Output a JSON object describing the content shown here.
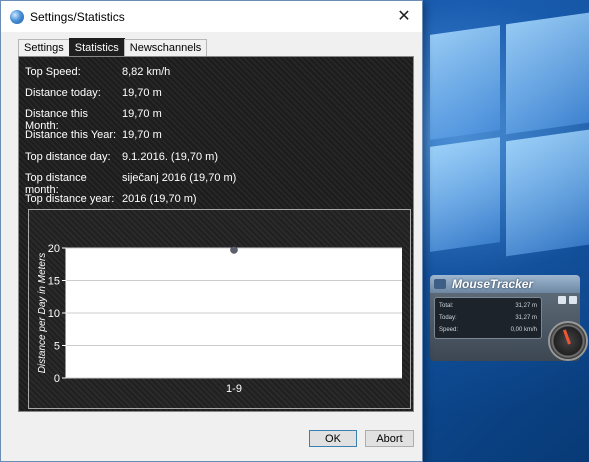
{
  "window": {
    "title": "Settings/Statistics",
    "close_glyph": "✕"
  },
  "tabs": [
    {
      "label": "Settings",
      "active": false
    },
    {
      "label": "Statistics",
      "active": true
    },
    {
      "label": "Newschannels",
      "active": false
    }
  ],
  "stats": [
    {
      "label": "Top Speed:",
      "value": "8,82 km/h"
    },
    {
      "label": "Distance today:",
      "value": "19,70 m"
    },
    {
      "label": "Distance this Month:",
      "value": "19,70 m"
    },
    {
      "label": "Distance this Year:",
      "value": "19,70 m"
    },
    {
      "label": "Top distance day:",
      "value": "9.1.2016. (19,70 m)"
    },
    {
      "label": "Top distance month:",
      "value": "siječanj 2016 (19,70 m)"
    },
    {
      "label": "Top distance year:",
      "value": "2016 (19,70 m)"
    }
  ],
  "chart_data": {
    "type": "scatter",
    "categories": [
      "1-9"
    ],
    "values": [
      19.7
    ],
    "ylabel": "Distance per Day in Meters",
    "xlabel": "",
    "ylim": [
      0,
      20
    ],
    "yticks": [
      0,
      5,
      10,
      15,
      20
    ],
    "grid": true,
    "colors": {
      "point": "#5a6070",
      "plot_bg": "#ffffff",
      "grid": "#cccccc",
      "text": "#ffffff"
    }
  },
  "buttons": {
    "ok": "OK",
    "abort": "Abort"
  },
  "gadget": {
    "title": "MouseTracker",
    "rows": [
      {
        "label": "Total:",
        "value": "31,27 m"
      },
      {
        "label": "Today:",
        "value": "31,27 m"
      },
      {
        "label": "Speed:",
        "value": "0,00 km/h"
      }
    ]
  }
}
